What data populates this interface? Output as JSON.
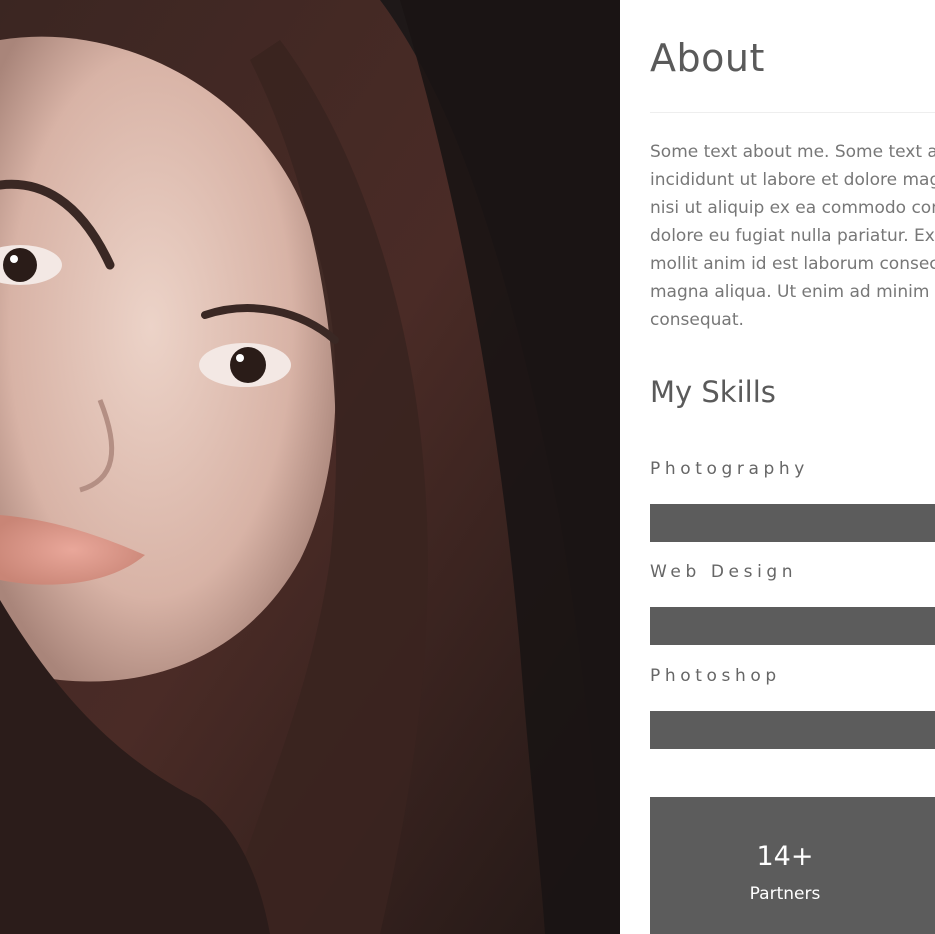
{
  "about": {
    "title": "About",
    "lines": [
      "Some text about me. Some text about me. Lorem ipsum",
      "incididunt ut labore et dolore magna aliqua. Ut enim",
      "nisi ut aliquip ex ea commodo consequat. Duis aute",
      "dolore eu fugiat nulla pariatur. Excepteur sint occaec",
      "mollit anim id est laborum consectetur adipiscing elit",
      "magna aliqua. Ut enim ad minim veniam, quis nostrud",
      "consequat."
    ]
  },
  "skills": {
    "title": "My Skills",
    "items": [
      {
        "label": "Photography",
        "level": 1.0
      },
      {
        "label": "Web Design",
        "level": 1.0
      },
      {
        "label": "Photoshop",
        "level": 1.0
      }
    ]
  },
  "stats": [
    {
      "number": "14+",
      "label": "Partners"
    }
  ],
  "colors": {
    "bar": "#5c5c5c",
    "heading": "#5a5a5a",
    "body_text": "#777777"
  }
}
